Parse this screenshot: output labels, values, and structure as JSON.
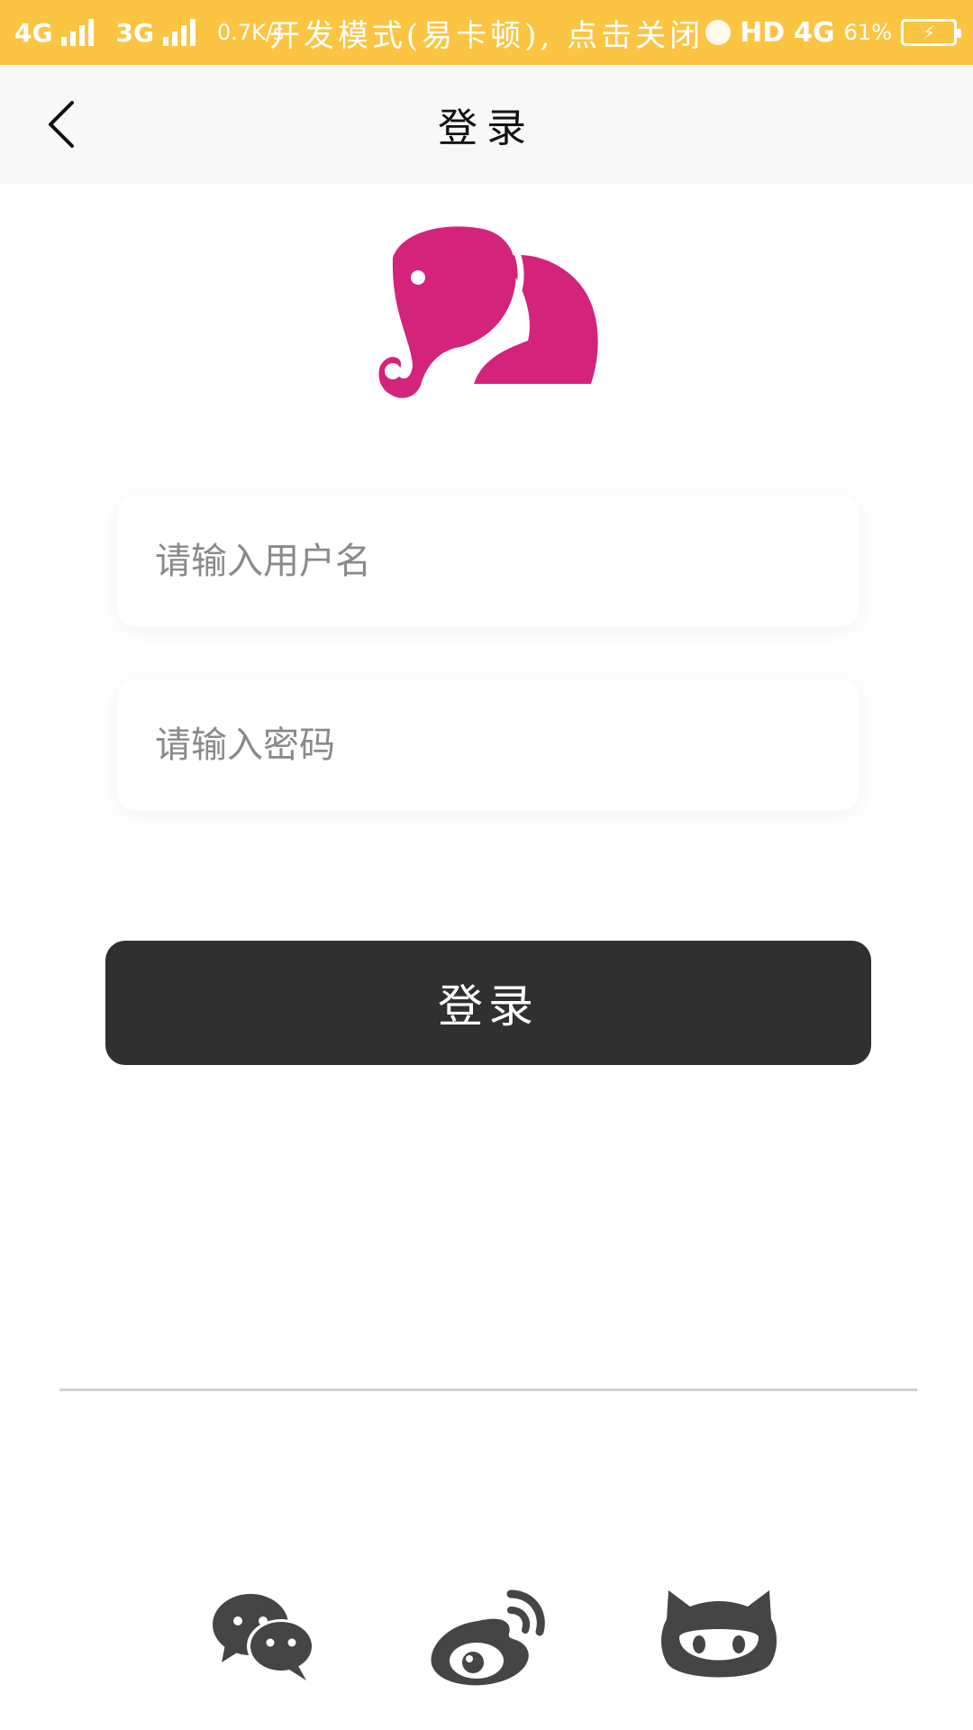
{
  "status_bar": {
    "network_1": "4G",
    "network_2": "3G",
    "speed": "0.7K/s",
    "notice": "开发模式(易卡顿), 点击关闭",
    "hd": "HD",
    "network_3": "4G",
    "battery_percent": "61%"
  },
  "nav": {
    "title": "登录",
    "back_icon": "chevron-left-icon"
  },
  "logo": {
    "icon": "elephant-logo",
    "color": "#D4237A"
  },
  "form": {
    "username_placeholder": "请输入用户名",
    "username_value": "",
    "password_placeholder": "请输入密码",
    "password_value": "",
    "login_label": "登录"
  },
  "social": [
    {
      "icon": "wechat-icon"
    },
    {
      "icon": "weibo-icon"
    },
    {
      "icon": "github-icon"
    }
  ],
  "colors": {
    "status_bar": "#FBC543",
    "button": "#303030",
    "icon": "#454545",
    "logo": "#D4237A"
  }
}
